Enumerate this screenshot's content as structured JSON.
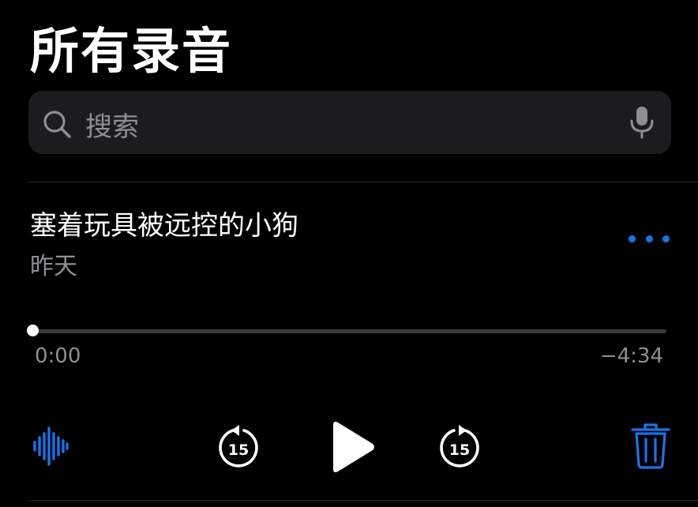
{
  "header": {
    "title": "所有录音"
  },
  "search": {
    "placeholder": "搜索"
  },
  "recording": {
    "title": "塞着玩具被远控的小狗",
    "date": "昨天",
    "progress": 0.0,
    "elapsed": "0:00",
    "remaining": "−4:34"
  },
  "controls": {
    "skip_back_seconds": "15",
    "skip_forward_seconds": "15"
  },
  "colors": {
    "background": "#000000",
    "accent": "#1a73e8",
    "secondary_text": "#8e8e93",
    "search_field": "#1c1c1e"
  },
  "icons": {
    "search": "magnifying-glass",
    "dictation": "microphone",
    "more": "ellipsis",
    "waveform": "waveform",
    "skip_back": "gobackward-15",
    "play": "play",
    "skip_forward": "goforward-15",
    "delete": "trash"
  }
}
